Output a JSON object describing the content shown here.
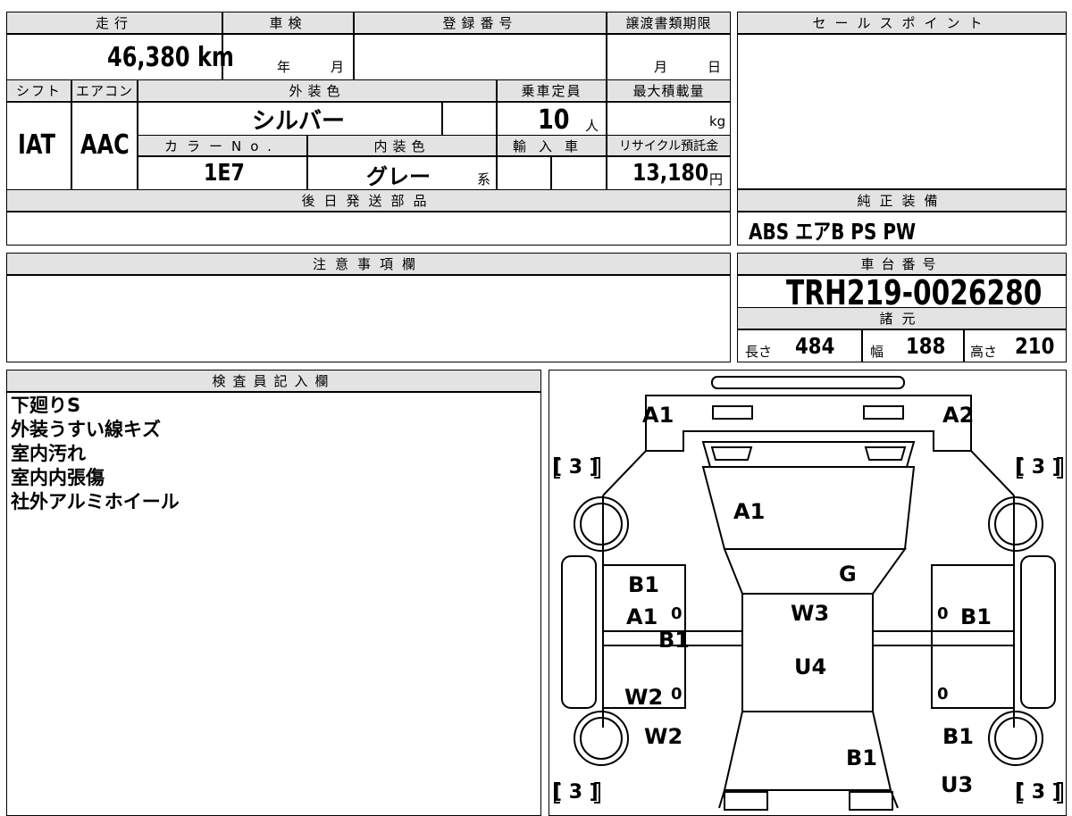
{
  "summary": {
    "mileage_label": "走行",
    "mileage_value": "46,380 km",
    "inspection_label": "車検",
    "inspection_year_unit": "年",
    "inspection_month_unit": "月",
    "registration_label": "登録番号",
    "transfer_label": "譲渡書類期限",
    "transfer_month_unit": "月",
    "transfer_day_unit": "日",
    "shift_label": "シフト",
    "shift_value": "IAT",
    "ac_label": "エアコン",
    "ac_value": "AAC",
    "exterior_label": "外装色",
    "exterior_value": "シルバー",
    "capacity_label": "乗車定員",
    "capacity_value": "10",
    "capacity_unit": "人",
    "load_label": "最大積載量",
    "load_unit": "kg",
    "colorno_label": "カラーNo.",
    "colorno_value": "1E7",
    "interior_label": "内装色",
    "interior_value": "グレー",
    "interior_suffix": "系",
    "import_label": "輸入車",
    "recycle_label": "リサイクル預託金",
    "recycle_value": "13,180",
    "recycle_unit": "円",
    "later_parts_label": "後日発送部品"
  },
  "sales": {
    "label": "セールスポイント"
  },
  "equipment": {
    "label": "純正装備",
    "value": "ABS エアB PS PW"
  },
  "notes": {
    "label": "注意事項欄"
  },
  "chassis": {
    "label": "車台番号",
    "value": "TRH219-0026280",
    "specs_label": "諸元",
    "length_label": "長さ",
    "length_value": "484",
    "width_label": "幅",
    "width_value": "188",
    "height_label": "高さ",
    "height_value": "210"
  },
  "inspector": {
    "label": "検査員記入欄",
    "lines": [
      "下廻りS",
      "外装うすい線キズ",
      "室内汚れ",
      "室内内張傷",
      "社外アルミホイール"
    ]
  },
  "diagram": {
    "marks": {
      "front_left": "A1",
      "front_right": "A2",
      "tread_fl": "[ 3 ]",
      "tread_fr": "[ 3 ]",
      "tread_rl": "[ 3 ]",
      "tread_rr": "[ 3 ]",
      "hood": "A1",
      "windshield": "G",
      "left_front_door_1": "B1",
      "left_front_door_2": "A1",
      "left_pillar": "B1",
      "left_rear_door": "W2",
      "left_rear": "W2",
      "roof_front": "W3",
      "roof_rear": "U4",
      "right_front_door": "B1",
      "right_rear": "B1",
      "rear_center": "B1",
      "right_bottom": "U3",
      "zero_1": "0",
      "zero_2": "0",
      "zero_3": "0",
      "zero_4": "0"
    }
  }
}
